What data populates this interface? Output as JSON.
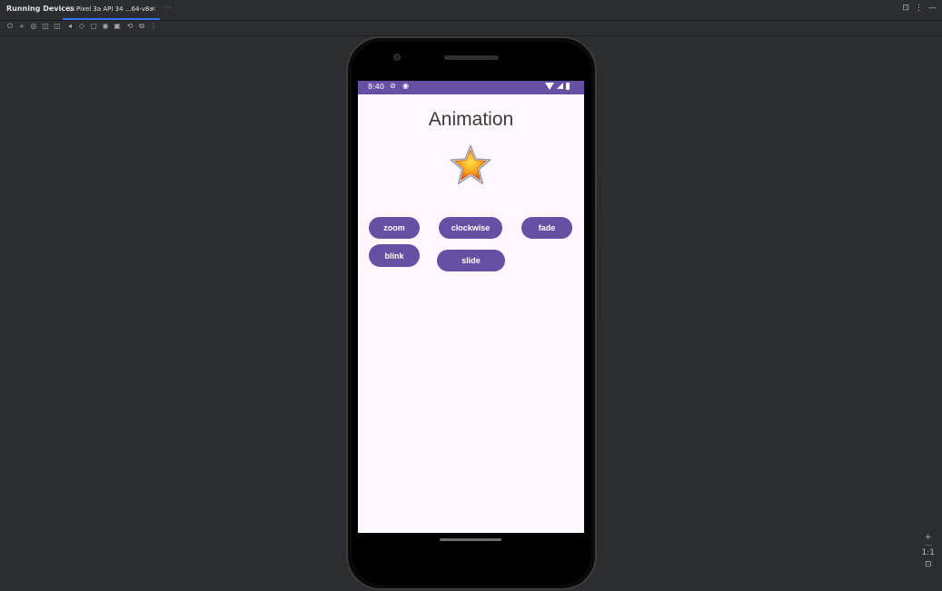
{
  "ide": {
    "tool_window_title": "Running Devices",
    "device_tab": {
      "label": "Pixel 3a API 34 ...64-v8a",
      "close": "×"
    },
    "tab_overflow": "···",
    "window_icons": [
      "⊡",
      "⋮",
      "—"
    ],
    "toolbar_icons": [
      "⏻",
      "«",
      "◎",
      "◫",
      "◫",
      "◂",
      "◇",
      "▢",
      "◉",
      "▣",
      "⟲",
      "⧉",
      "⋮"
    ]
  },
  "device": {
    "status_bar": {
      "time": "8:40"
    },
    "app": {
      "title": "Animation",
      "buttons": {
        "zoom": "zoom",
        "clockwise": "clockwise",
        "fade": "fade",
        "blink": "blink",
        "slide": "slide"
      }
    }
  },
  "zoom_controls": {
    "plus": "+",
    "reset": "1:1",
    "fit": "⊡"
  },
  "colors": {
    "accent": "#6650a4",
    "screen_bg": "#fef7ff",
    "ide_bg": "#2b2d30",
    "tab_underline": "#3574f0"
  }
}
